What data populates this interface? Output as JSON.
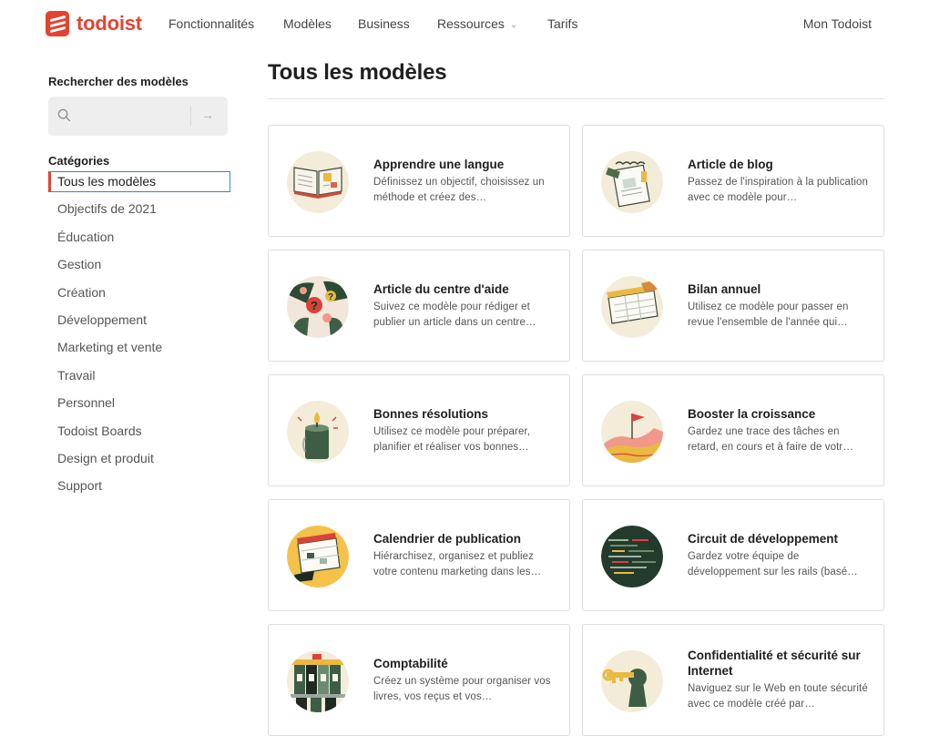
{
  "brand": {
    "name": "todoist",
    "color": "#e44332"
  },
  "nav": {
    "items": [
      "Fonctionnalités",
      "Modèles",
      "Business",
      "Ressources",
      "Tarifs"
    ],
    "account": "Mon Todoist"
  },
  "sidebar": {
    "search_title": "Rechercher des modèles",
    "search_placeholder": "",
    "categories_title": "Catégories",
    "categories": [
      "Tous les modèles",
      "Objectifs de 2021",
      "Éducation",
      "Gestion",
      "Création",
      "Développement",
      "Marketing et vente",
      "Travail",
      "Personnel",
      "Todoist Boards",
      "Design et produit",
      "Support"
    ],
    "active_category": "Tous les modèles"
  },
  "main": {
    "title": "Tous les modèles",
    "cards": [
      {
        "title": "Apprendre une langue",
        "desc": "Définissez un objectif, choisissez un méthode et créez des…",
        "icon": "open-book-icon"
      },
      {
        "title": "Article de blog",
        "desc": "Passez de l'inspiration à la publication avec ce modèle pour…",
        "icon": "notepad-icon"
      },
      {
        "title": "Article du centre d'aide",
        "desc": "Suivez ce modèle pour rédiger et publier un article dans un centre…",
        "icon": "question-marks-icon"
      },
      {
        "title": "Bilan annuel",
        "desc": "Utilisez ce modèle pour passer en revue l'ensemble de l'année qui…",
        "icon": "calendar-icon"
      },
      {
        "title": "Bonnes résolutions",
        "desc": "Utilisez ce modèle pour préparer, planifier et réaliser vos bonnes…",
        "icon": "candle-icon"
      },
      {
        "title": "Booster la croissance",
        "desc": "Gardez une trace des tâches en retard, en cours et à faire de votr…",
        "icon": "flag-mountain-icon"
      },
      {
        "title": "Calendrier de publication",
        "desc": "Hiérarchisez, organisez et publiez votre contenu marketing dans les…",
        "icon": "publishing-calendar-icon"
      },
      {
        "title": "Circuit de développement",
        "desc": "Gardez votre équipe de développement sur les rails (basé…",
        "icon": "code-editor-icon"
      },
      {
        "title": "Comptabilité",
        "desc": "Créez un système pour organiser vos livres, vos reçus et vos…",
        "icon": "binders-icon"
      },
      {
        "title": "Confidentialité et sécurité sur Internet",
        "desc": "Naviguez sur le Web en toute sécurité avec ce modèle créé par…",
        "icon": "keyhole-icon"
      }
    ]
  },
  "colors": {
    "accent": "#e44332",
    "focus": "#3b7ddd",
    "card_border": "#dedede",
    "illus_bg": "#f3ecd9"
  }
}
